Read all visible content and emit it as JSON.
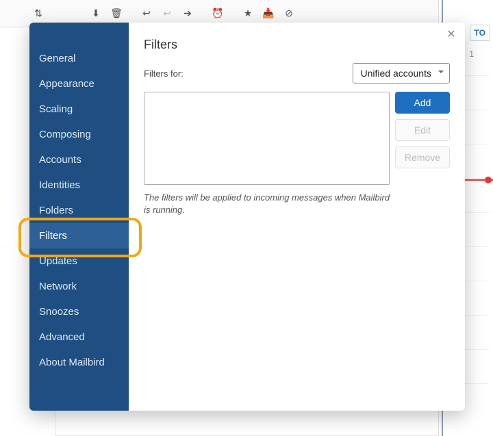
{
  "toolbar": {
    "icons": [
      "sort",
      "download",
      "trash",
      "reply",
      "reply-all",
      "forward",
      "clock",
      "star",
      "archive",
      "block"
    ]
  },
  "right_panel": {
    "today_label": "TO",
    "badge": "1"
  },
  "modal": {
    "sidebar": {
      "items": [
        {
          "label": "General",
          "key": "general"
        },
        {
          "label": "Appearance",
          "key": "appearance"
        },
        {
          "label": "Scaling",
          "key": "scaling"
        },
        {
          "label": "Composing",
          "key": "composing"
        },
        {
          "label": "Accounts",
          "key": "accounts"
        },
        {
          "label": "Identities",
          "key": "identities"
        },
        {
          "label": "Folders",
          "key": "folders"
        },
        {
          "label": "Filters",
          "key": "filters",
          "active": true
        },
        {
          "label": "Updates",
          "key": "updates"
        },
        {
          "label": "Network",
          "key": "network"
        },
        {
          "label": "Snoozes",
          "key": "snoozes"
        },
        {
          "label": "Advanced",
          "key": "advanced"
        },
        {
          "label": "About Mailbird",
          "key": "about"
        }
      ]
    },
    "panel": {
      "title": "Filters",
      "filters_for_label": "Filters for:",
      "account_selected": "Unified accounts",
      "buttons": {
        "add": "Add",
        "edit": "Edit",
        "remove": "Remove"
      },
      "hint": "The filters will be applied to incoming messages when Mailbird is running."
    }
  }
}
